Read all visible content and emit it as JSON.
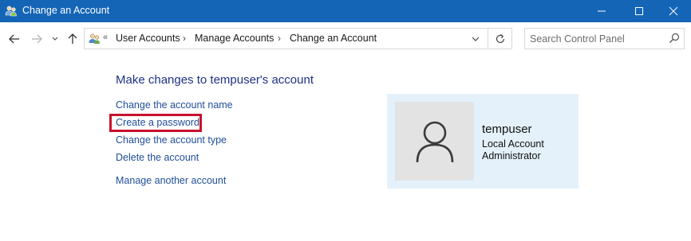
{
  "window": {
    "title": "Change an Account",
    "controls": {
      "minimize": "minimize",
      "maximize": "maximize",
      "close": "close"
    }
  },
  "navigation": {
    "breadcrumb_prefix": "«",
    "breadcrumbs": [
      "User Accounts",
      "Manage Accounts",
      "Change an Account"
    ],
    "separator": "›",
    "search_placeholder": "Search Control Panel"
  },
  "main": {
    "heading": "Make changes to tempuser's account",
    "links": [
      {
        "label": "Change the account name"
      },
      {
        "label": "Create a password",
        "highlighted": true,
        "highlight_color": "#c8102e"
      },
      {
        "label": "Change the account type"
      },
      {
        "label": "Delete the account"
      },
      {
        "label": "Manage another account"
      }
    ]
  },
  "account": {
    "name": "tempuser",
    "type": "Local Account",
    "role": "Administrator",
    "avatar_icon": "user-silhouette-icon"
  },
  "colors": {
    "titlebar": "#1565b7",
    "link": "#1f4e98",
    "heading": "#1e3287",
    "card_background": "#e4f1fb",
    "highlight": "#c8102e"
  }
}
